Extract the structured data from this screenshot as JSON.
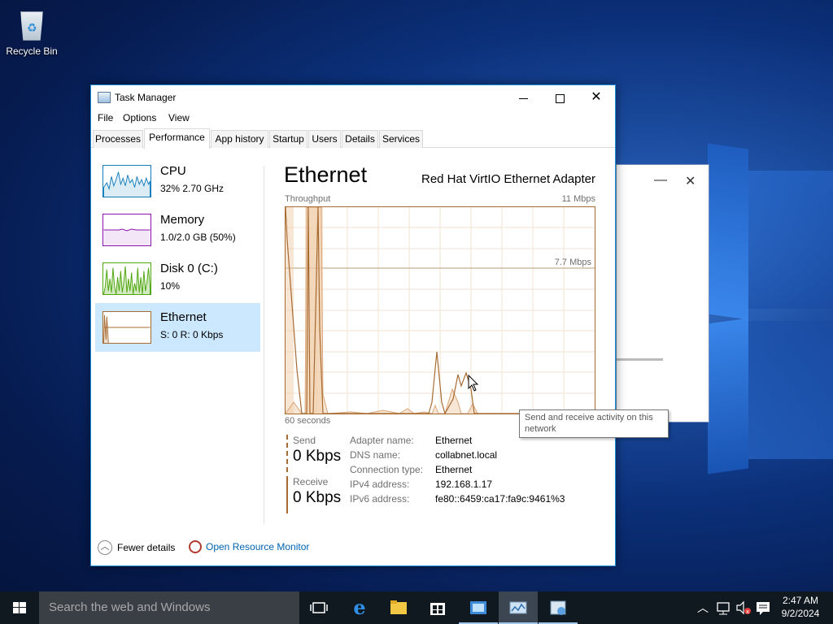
{
  "desktop": {
    "icons": [
      {
        "label": "Recycle Bin",
        "icon": "recycle-bin-icon"
      }
    ]
  },
  "window": {
    "title": "Task Manager",
    "menu": [
      "File",
      "Options",
      "View"
    ],
    "tabs": [
      "Processes",
      "Performance",
      "App history",
      "Startup",
      "Users",
      "Details",
      "Services"
    ],
    "active_tab": "Performance"
  },
  "sidebar": {
    "items": [
      {
        "name": "CPU",
        "sub": "32%  2.70 GHz",
        "color": "#117dbb",
        "selected": false
      },
      {
        "name": "Memory",
        "sub": "1.0/2.0 GB (50%)",
        "color": "#8b12ae",
        "selected": false
      },
      {
        "name": "Disk 0 (C:)",
        "sub": "10%",
        "color": "#4da60c",
        "selected": false
      },
      {
        "name": "Ethernet",
        "sub": "S: 0  R: 0 Kbps",
        "color": "#a76b32",
        "selected": true
      }
    ]
  },
  "main": {
    "title": "Ethernet",
    "adapter": "Red Hat VirtIO Ethernet Adapter",
    "throughput_label": "Throughput",
    "throughput_max": "11 Mbps",
    "gridline_label": "7.7 Mbps",
    "time_label": "60 seconds",
    "send_label": "Send",
    "send_value": "0 Kbps",
    "receive_label": "Receive",
    "receive_value": "0 Kbps",
    "properties": [
      {
        "key": "Adapter name:",
        "value": "Ethernet"
      },
      {
        "key": "DNS name:",
        "value": "collabnet.local"
      },
      {
        "key": "Connection type:",
        "value": "Ethernet"
      },
      {
        "key": "IPv4 address:",
        "value": "192.168.1.17"
      },
      {
        "key": "IPv6 address:",
        "value": "fe80::6459:ca17:fa9c:9461%3"
      }
    ],
    "tooltip": "Send and receive activity on this network"
  },
  "footer": {
    "fewer_details": "Fewer details",
    "open_resource_monitor": "Open Resource Monitor"
  },
  "taskbar": {
    "search_placeholder": "Search the web and Windows",
    "time": "2:47 AM",
    "date": "9/2/2024"
  }
}
